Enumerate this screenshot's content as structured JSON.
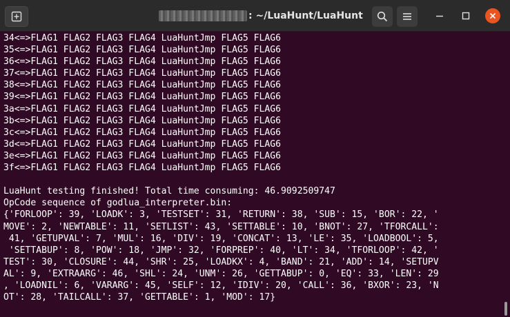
{
  "window": {
    "title_prefix_redacted": "",
    "title": ": ~/LuaHunt/LuaHunt",
    "colors": {
      "titlebar": "#2b2b2b",
      "terminal_bg": "#300a24",
      "close": "#e95420",
      "text": "#ffffff"
    }
  },
  "icons": {
    "new_tab": "new-tab-icon",
    "search": "search-icon",
    "menu": "hamburger-menu-icon",
    "minimize": "minimize-icon",
    "maximize": "maximize-icon",
    "close": "close-icon"
  },
  "terminal": {
    "lines": [
      "34<=>FLAG1 FLAG2 FLAG3 FLAG4 LuaHuntJmp FLAG5 FLAG6",
      "35<=>FLAG1 FLAG2 FLAG3 FLAG4 LuaHuntJmp FLAG5 FLAG6",
      "36<=>FLAG1 FLAG2 FLAG3 FLAG4 LuaHuntJmp FLAG5 FLAG6",
      "37<=>FLAG1 FLAG2 FLAG3 FLAG4 LuaHuntJmp FLAG5 FLAG6",
      "38<=>FLAG1 FLAG2 FLAG3 FLAG4 LuaHuntJmp FLAG5 FLAG6",
      "39<=>FLAG1 FLAG2 FLAG3 FLAG4 LuaHuntJmp FLAG5 FLAG6",
      "3a<=>FLAG1 FLAG2 FLAG3 FLAG4 LuaHuntJmp FLAG5 FLAG6",
      "3b<=>FLAG1 FLAG2 FLAG3 FLAG4 LuaHuntJmp FLAG5 FLAG6",
      "3c<=>FLAG1 FLAG2 FLAG3 FLAG4 LuaHuntJmp FLAG5 FLAG6",
      "3d<=>FLAG1 FLAG2 FLAG3 FLAG4 LuaHuntJmp FLAG5 FLAG6",
      "3e<=>FLAG1 FLAG2 FLAG3 FLAG4 LuaHuntJmp FLAG5 FLAG6",
      "3f<=>FLAG1 FLAG2 FLAG3 FLAG4 LuaHuntJmp FLAG5 FLAG6",
      "",
      "LuaHunt testing finished! Total time consuming: 46.9092509747",
      "OpCode sequence of godlua_interpreter.bin:",
      "{'FORLOOP': 39, 'LOADK': 3, 'TESTSET': 31, 'RETURN': 38, 'SUB': 15, 'BOR': 22, '",
      "MOVE': 2, 'NEWTABLE': 11, 'SETLIST': 43, 'SETTABLE': 10, 'BNOT': 27, 'TFORCALL':",
      " 41, 'GETUPVAL': 7, 'MUL': 16, 'DIV': 19, 'CONCAT': 13, 'LE': 35, 'LOADBOOL': 5,",
      " 'SETTABUP': 8, 'POW': 18, 'JMP': 32, 'FORPREP': 40, 'LT': 34, 'TFORLOOP': 42, '",
      "TEST': 30, 'CLOSURE': 44, 'SHR': 25, 'LOADKX': 4, 'BAND': 21, 'ADD': 14, 'SETUPV",
      "AL': 9, 'EXTRAARG': 46, 'SHL': 24, 'UNM': 26, 'GETTABUP': 0, 'EQ': 33, 'LEN': 29",
      ", 'LOADNIL': 6, 'VARARG': 45, 'SELF': 12, 'IDIV': 20, 'CALL': 36, 'BXOR': 23, 'N",
      "OT': 28, 'TAILCALL': 37, 'GETTABLE': 1, 'MOD': 17}"
    ]
  }
}
